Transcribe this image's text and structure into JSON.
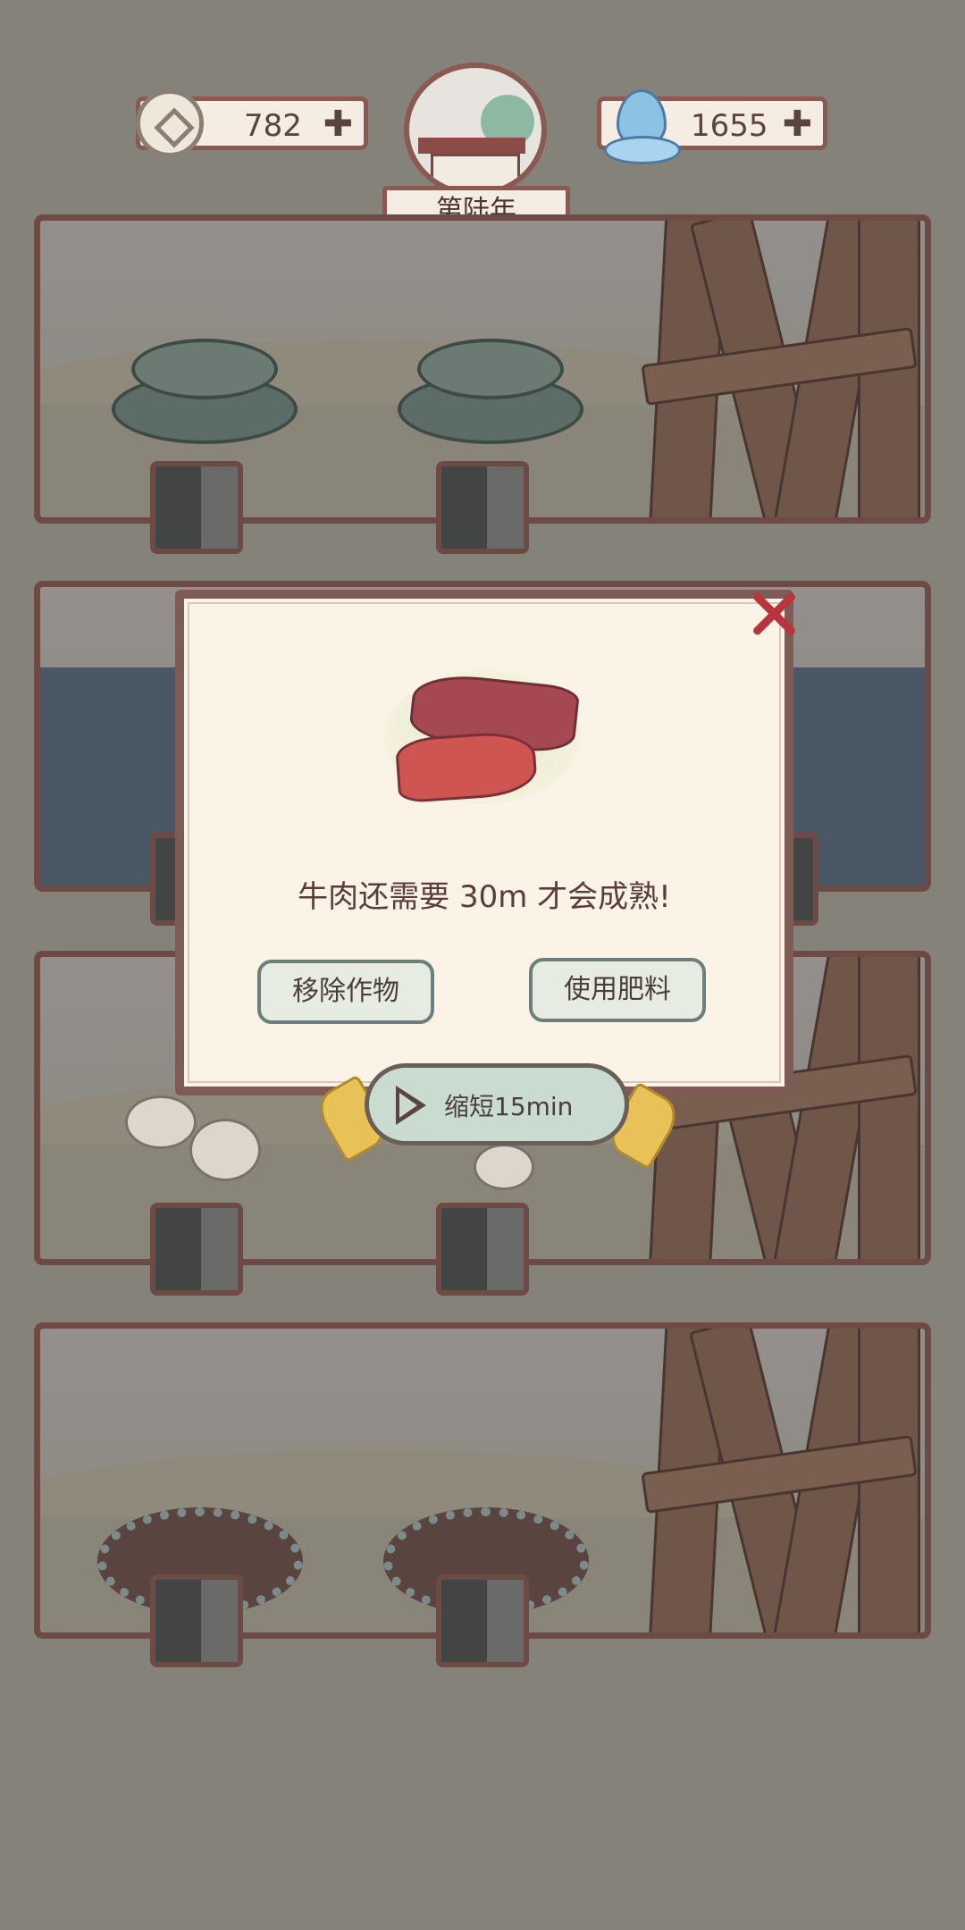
{
  "resources": {
    "coins": "782",
    "coins_plus": "✚",
    "spirit": "1655",
    "spirit_plus": "✚"
  },
  "year": "第陆年",
  "dialog": {
    "message": "牛肉还需要 30m 才会成熟!",
    "remove_button": "移除作物",
    "fertilizer_button": "使用肥料",
    "video_button": "缩短15min"
  },
  "colors": {
    "accent": "#8a5a52",
    "close": "#b8353e",
    "button_green": "#c9dccf"
  },
  "icons": {
    "coin": "square-hole-coin-icon",
    "spirit": "water-drop-icon",
    "play": "play-icon",
    "close": "close-x-icon"
  }
}
